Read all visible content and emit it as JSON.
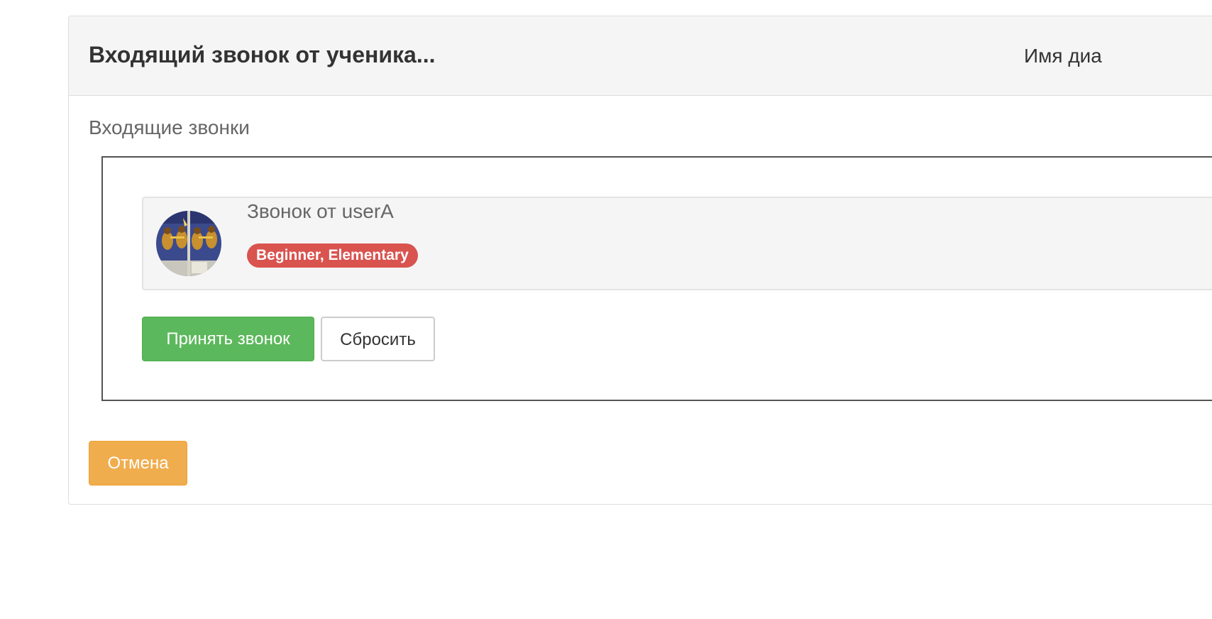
{
  "panel": {
    "title": "Входящий звонок от ученика...",
    "dialog_name_label": "Имя диа"
  },
  "incoming_calls": {
    "section_label": "Входящие звонки",
    "calls": [
      {
        "caller": "Звонок от userA",
        "level": "Beginner, Elementary",
        "avatar_icon": "user-avatar-image"
      }
    ]
  },
  "actions": {
    "accept_label": "Принять звонок",
    "reject_label": "Сбросить",
    "cancel_label": "Отмена"
  },
  "colors": {
    "accept": "#5cb85c",
    "cancel": "#f0ad4e",
    "badge": "#d9534f",
    "header_bg": "#f5f5f5"
  }
}
